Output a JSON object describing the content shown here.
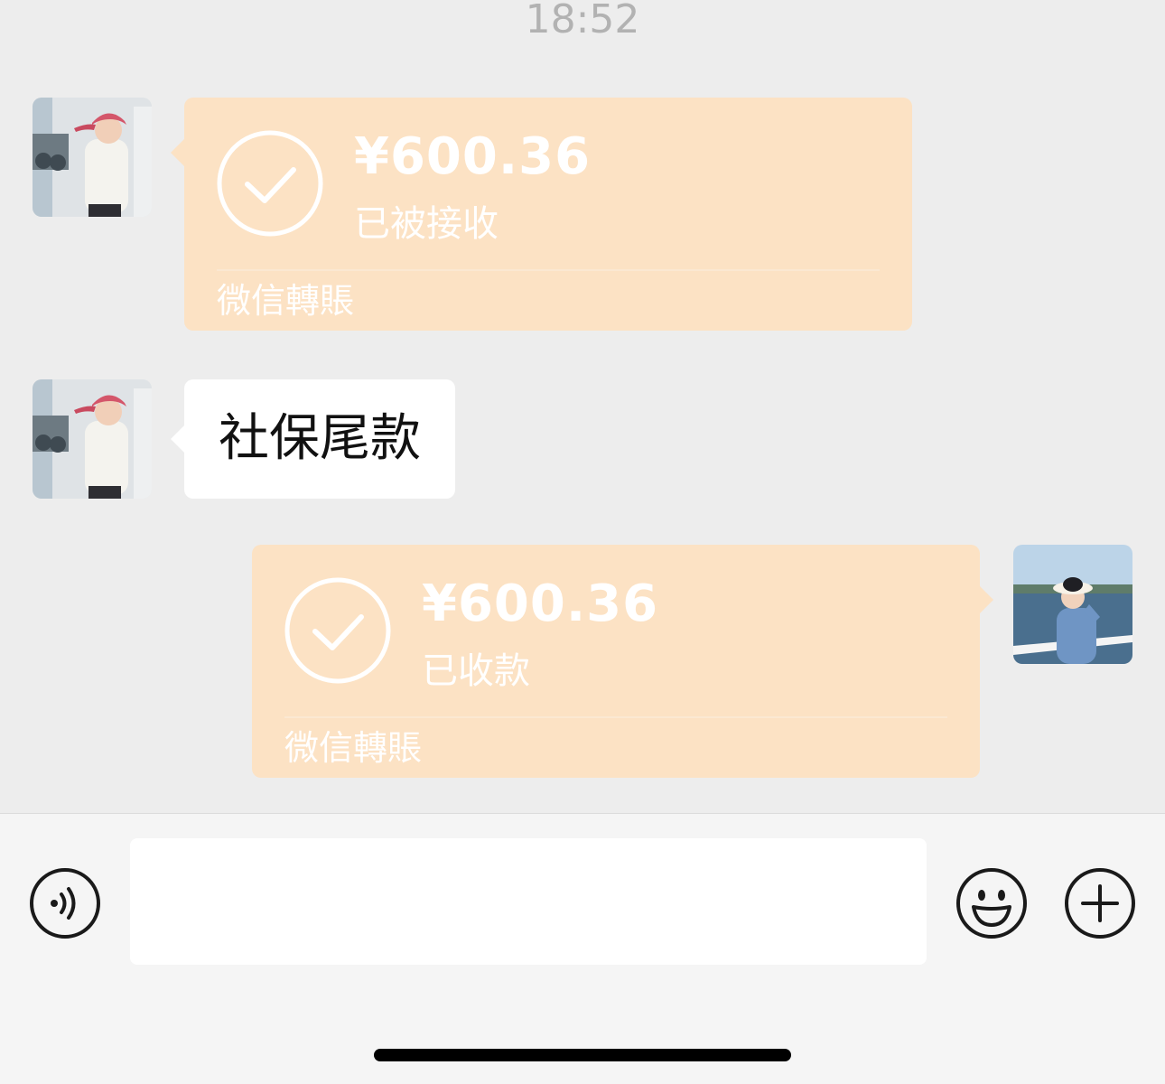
{
  "chat": {
    "timestamp": "18:52",
    "messages": [
      {
        "type": "transfer",
        "side": "left",
        "amount": "¥600.36",
        "status": "已被接收",
        "footer": "微信轉賬"
      },
      {
        "type": "text",
        "side": "left",
        "text": "社保尾款"
      },
      {
        "type": "transfer",
        "side": "right",
        "amount": "¥600.36",
        "status": "已收款",
        "footer": "微信轉賬"
      }
    ]
  },
  "input_bar": {
    "icons": [
      "voice-icon",
      "emoji-icon",
      "plus-icon"
    ],
    "text_value": ""
  },
  "colors": {
    "background": "#ededed",
    "transfer_bubble": "#fce2c4",
    "text_bubble": "#ffffff",
    "input_bar": "#f5f5f5"
  }
}
